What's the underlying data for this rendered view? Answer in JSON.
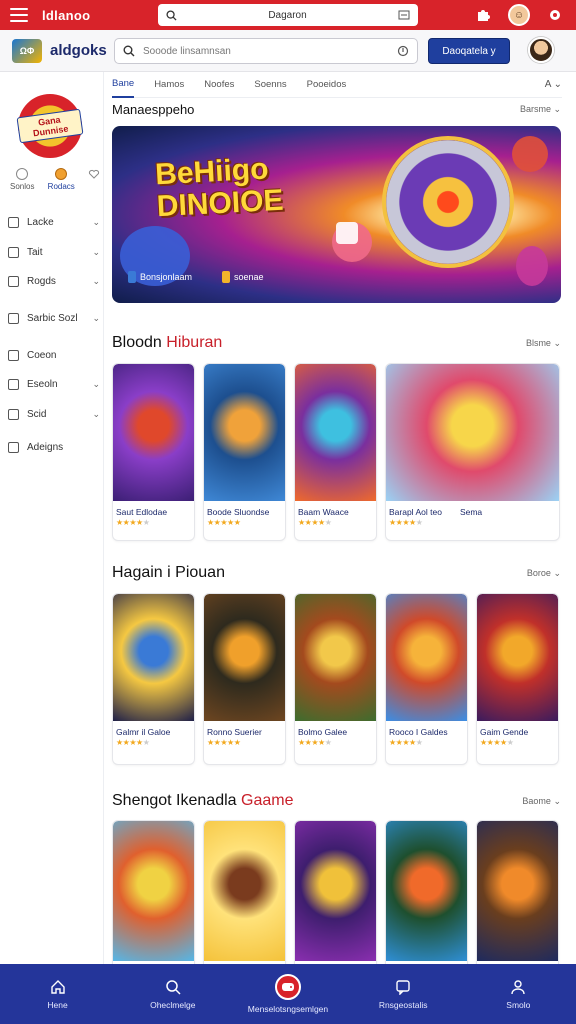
{
  "topbar": {
    "brand": "ldlanoo",
    "search_text": "Dagaron"
  },
  "header": {
    "logo_mark": "ΩΦ",
    "brand": "aldgoks",
    "search_placeholder": "Sooode linsamnsan",
    "primary_button": "Daoqatela y"
  },
  "sidebar": {
    "logo_text": "Gana Dunnise",
    "mini_items": [
      {
        "label": "Sonlos"
      },
      {
        "label": "Rodacs"
      }
    ],
    "items": [
      {
        "label": "Lacke",
        "has_chevron": true
      },
      {
        "label": "Tait",
        "has_chevron": true
      },
      {
        "label": "Rogds",
        "has_chevron": true
      },
      {
        "label": "Sarbic Sozl",
        "has_chevron": true
      },
      {
        "label": "Coeon",
        "has_chevron": false
      },
      {
        "label": "Eseoln",
        "has_chevron": true
      },
      {
        "label": "Scid",
        "has_chevron": true
      },
      {
        "label": "Adeigns",
        "has_chevron": false
      }
    ]
  },
  "tabs": {
    "items": [
      "Bane",
      "Hamos",
      "Noofes",
      "Soenns",
      "Pooeidos"
    ],
    "sort_label": "A"
  },
  "featured": {
    "title": "Manaesppeho",
    "more": "Barsme",
    "banner_title_line1": "BeHiigo",
    "banner_title_line2": "DINOIOE",
    "banner_chip1": "Bonsjonlaam",
    "banner_chip2": "soenae"
  },
  "section1": {
    "title_plain": "Bloodn",
    "title_accent": "Hiburan",
    "more": "Blsme",
    "games": [
      {
        "name": "Saut Edlodae",
        "stars": 4,
        "colors": [
          "#3b1f74",
          "#e0482b",
          "#8a3ec8"
        ]
      },
      {
        "name": "Boode Sluondse",
        "stars": 5,
        "colors": [
          "#3f88d6",
          "#f0a23a",
          "#1d4f8f"
        ]
      },
      {
        "name": "Baam Waace",
        "stars": 4,
        "colors": [
          "#f06a2b",
          "#3ec0e0",
          "#7a2f9e"
        ]
      },
      {
        "name": "Barapl Aol teo",
        "stars": 4,
        "colors": [
          "#9ad2f5",
          "#f7d64a",
          "#e04a6c"
        ]
      },
      {
        "name": "Sema",
        "stars": 3,
        "colors": [
          "#a4d7ef",
          "#ef5a4a",
          "#42b36e"
        ]
      }
    ]
  },
  "section2": {
    "title": "Hagain i Piouan",
    "more": "Boroe",
    "games": [
      {
        "name": "Galmr il Galoe",
        "stars": 4,
        "colors": [
          "#1e1f48",
          "#3a7ad6",
          "#f5c842"
        ]
      },
      {
        "name": "Ronno Suerier",
        "stars": 5,
        "colors": [
          "#6e4620",
          "#f0a02b",
          "#2e2a1e"
        ]
      },
      {
        "name": "Bolmo Galee",
        "stars": 4,
        "colors": [
          "#3c6d2e",
          "#f2c84a",
          "#a44a1e"
        ]
      },
      {
        "name": "Rooco I Galdes",
        "stars": 4,
        "colors": [
          "#3a8ee6",
          "#f6b33a",
          "#d04a2a"
        ]
      },
      {
        "name": "Gaim Gende",
        "stars": 4,
        "colors": [
          "#3a1b5e",
          "#f2a82a",
          "#c0302a"
        ]
      }
    ]
  },
  "section3": {
    "title_plain": "Shengot Ikenadla",
    "title_accent": "Gaame",
    "more": "Baome",
    "games": [
      {
        "colors": [
          "#54b7e8",
          "#f0d243",
          "#e0602e"
        ]
      },
      {
        "colors": [
          "#f4c23a",
          "#7a3b1e",
          "#ffe27a"
        ]
      },
      {
        "colors": [
          "#8a2fb0",
          "#f0c13a",
          "#3e1e6e"
        ]
      },
      {
        "colors": [
          "#2f8fd6",
          "#f06a2a",
          "#1e4f2e"
        ]
      },
      {
        "colors": [
          "#1e2a5e",
          "#f08a2a",
          "#6a3e1e"
        ]
      }
    ]
  },
  "bottom_nav": [
    {
      "label": "Hene",
      "icon": "home-icon"
    },
    {
      "label": "Oheclmelge",
      "icon": "search-icon"
    },
    {
      "label": "Menselotsngsemlgen",
      "icon": "gamepad-icon"
    },
    {
      "label": "Rnsgeostalis",
      "icon": "chat-icon"
    },
    {
      "label": "Smolo",
      "icon": "profile-icon"
    }
  ]
}
